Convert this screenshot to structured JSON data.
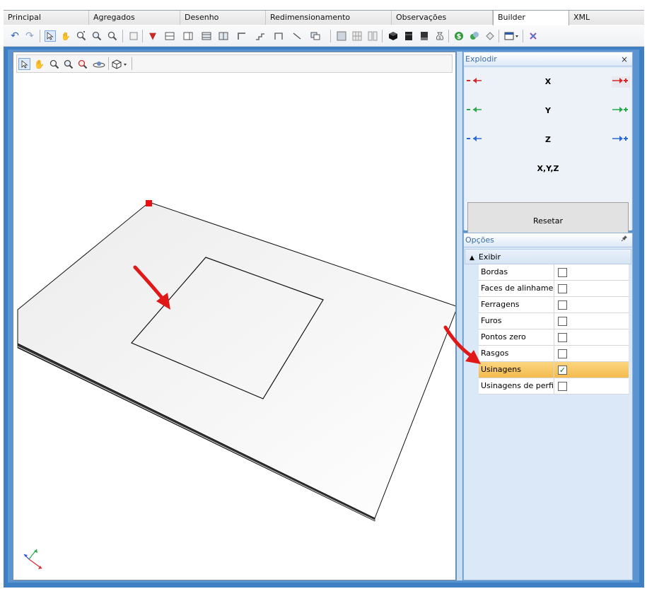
{
  "tabs": [
    {
      "label": "Principal",
      "active": false
    },
    {
      "label": "Agregados",
      "active": false
    },
    {
      "label": "Desenho",
      "active": false
    },
    {
      "label": "Redimensionamento",
      "active": false
    },
    {
      "label": "Observações",
      "active": false
    },
    {
      "label": "Builder",
      "active": true
    },
    {
      "label": "XML",
      "active": false
    }
  ],
  "toolbar": {
    "icons": [
      "undo-icon",
      "redo-icon",
      "select-icon",
      "pan-icon",
      "zoom-in-icon",
      "zoom-window-icon",
      "zoom-out-icon",
      "box-icon",
      "drill-icon",
      "panel-horizontal-icon",
      "panel-vertical-icon",
      "shelf-icon",
      "cabinet-icon",
      "corner-icon",
      "stairs-icon",
      "frame-icon",
      "line-icon",
      "copy-icon",
      "render-icon",
      "grid-icon",
      "columns-icon",
      "cube-black-icon",
      "cabinet-dark-icon",
      "box-dark-icon",
      "money-bag-icon",
      "dollar-icon",
      "coins-icon",
      "label-icon",
      "window-icon",
      "tool-icon"
    ]
  },
  "viewport": {
    "toolbar_icons": [
      "select-arrow-icon",
      "pan-hand-icon",
      "zoom-in-icon",
      "zoom-extents-icon",
      "zoom-out-icon",
      "orbit-icon",
      "view-cube-icon"
    ]
  },
  "explode_panel": {
    "title": "Explodir",
    "close_label": "×",
    "axes": [
      {
        "label": "X",
        "color": "#d42a2a"
      },
      {
        "label": "Y",
        "color": "#2aa84a"
      },
      {
        "label": "Z",
        "color": "#2a6ad4"
      }
    ],
    "all_axes_label": "X,Y,Z",
    "reset_label": "Resetar"
  },
  "options_panel": {
    "title": "Opções",
    "pin_label": "📌",
    "group_label": "Exibir",
    "items": [
      {
        "label": "Bordas",
        "checked": false,
        "highlighted": false
      },
      {
        "label": "Faces de alinhame...",
        "checked": false,
        "highlighted": false
      },
      {
        "label": "Ferragens",
        "checked": false,
        "highlighted": false
      },
      {
        "label": "Furos",
        "checked": false,
        "highlighted": false
      },
      {
        "label": "Pontos zero",
        "checked": false,
        "highlighted": false
      },
      {
        "label": "Rasgos",
        "checked": false,
        "highlighted": false
      },
      {
        "label": "Usinagens",
        "checked": true,
        "highlighted": true
      },
      {
        "label": "Usinagens de perfil",
        "checked": false,
        "highlighted": false
      }
    ]
  },
  "colors": {
    "accent": "#3f7fc4",
    "highlight": "#f5bb4e",
    "annotation_arrow": "#e01818",
    "corner_marker": "#e51010"
  }
}
